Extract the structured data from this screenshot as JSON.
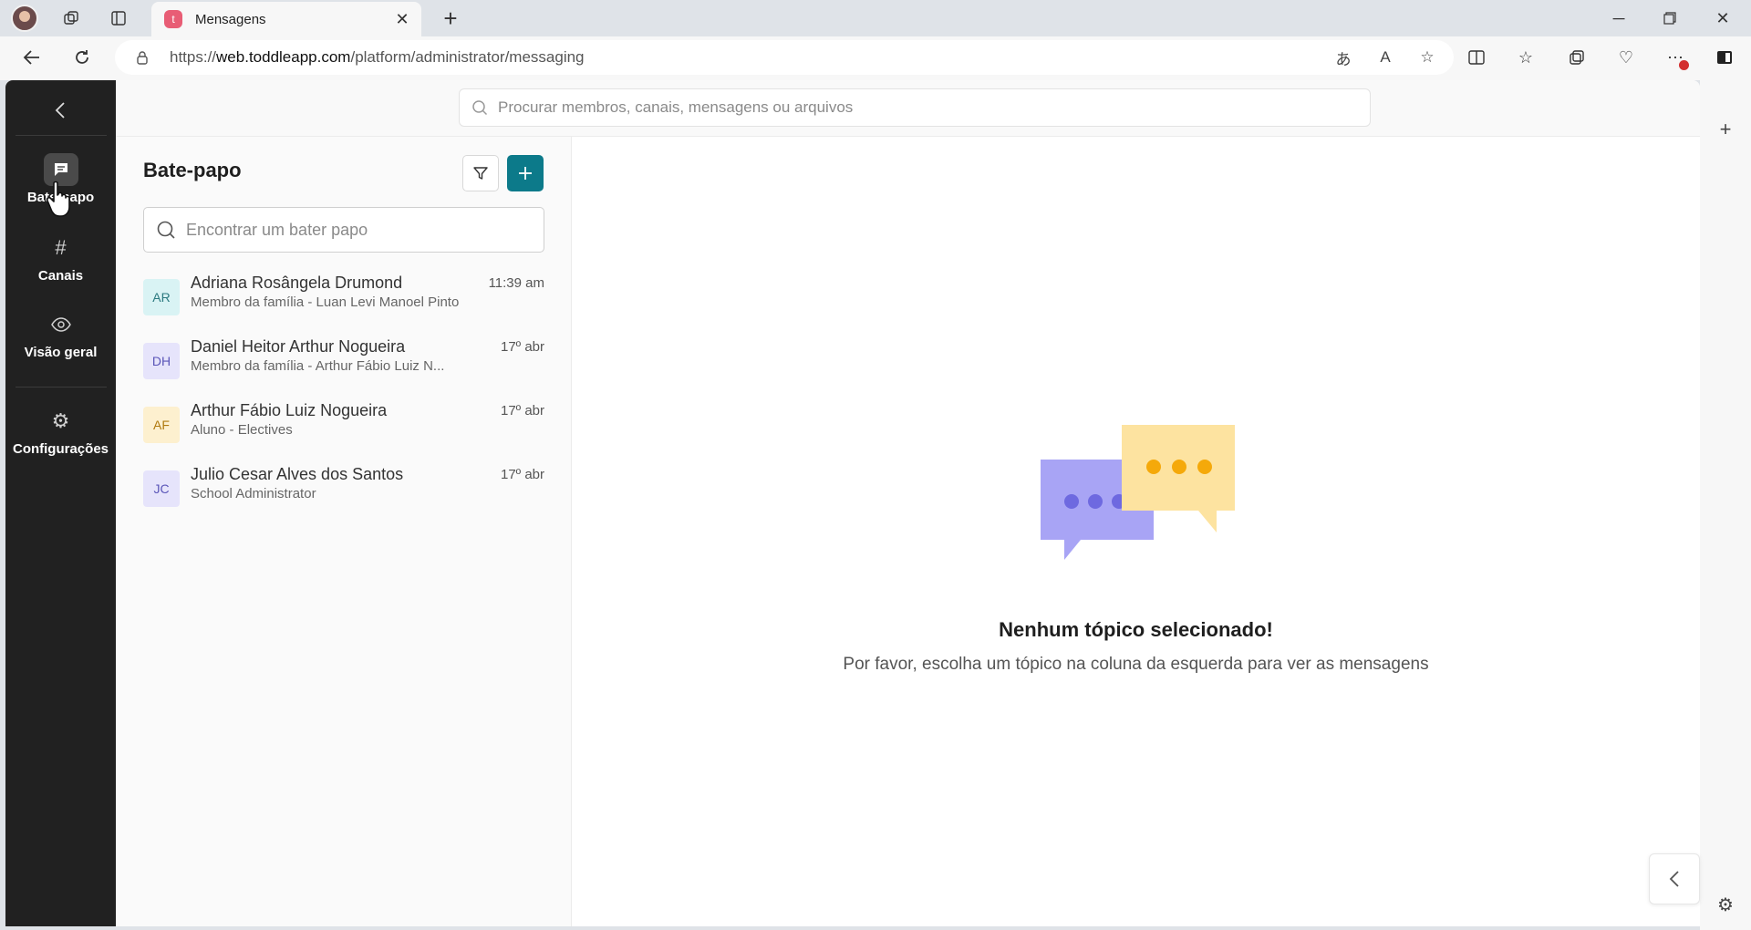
{
  "browser": {
    "tab_title": "Mensagens",
    "tab_favicon_letter": "t",
    "url_prefix": "https://",
    "url_host": "web.toddleapp.com",
    "url_path": "/platform/administrator/messaging"
  },
  "nav": {
    "items": [
      {
        "label": "Bate-papo",
        "icon": "chat-icon"
      },
      {
        "label": "Canais",
        "icon": "hash-icon"
      },
      {
        "label": "Visão geral",
        "icon": "eye-icon"
      },
      {
        "label": "Configurações",
        "icon": "gear-icon"
      }
    ]
  },
  "search": {
    "placeholder": "Procurar membros, canais, mensagens ou arquivos"
  },
  "chat_panel": {
    "title": "Bate-papo",
    "search_placeholder": "Encontrar um bater papo",
    "chats": [
      {
        "initials": "AR",
        "name": "Adriana Rosângela Drumond",
        "subtitle": "Membro da família - Luan Levi Manoel Pinto",
        "time": "11:39 am",
        "avatar_bg": "#d9f3f4",
        "avatar_fg": "#2c7a80"
      },
      {
        "initials": "DH",
        "name": "Daniel Heitor Arthur Nogueira",
        "subtitle": "Membro da família - Arthur Fábio Luiz N...",
        "time": "17º abr",
        "avatar_bg": "#e6e4fb",
        "avatar_fg": "#5a55b8"
      },
      {
        "initials": "AF",
        "name": "Arthur Fábio Luiz Nogueira",
        "subtitle": "Aluno - Electives",
        "time": "17º abr",
        "avatar_bg": "#fdf0cf",
        "avatar_fg": "#b07a10"
      },
      {
        "initials": "JC",
        "name": "Julio Cesar Alves dos Santos",
        "subtitle": "School Administrator",
        "time": "17º abr",
        "avatar_bg": "#e6e4fb",
        "avatar_fg": "#5a55b8"
      }
    ]
  },
  "empty_state": {
    "title": "Nenhum tópico selecionado!",
    "subtitle": "Por favor, escolha um tópico na coluna da esquerda para ver as mensagens"
  },
  "colors": {
    "nav_bg": "#212121",
    "accent": "#0c7a8a",
    "bubble_purple": "#a8a4f5",
    "bubble_yellow": "#fde3a0"
  }
}
